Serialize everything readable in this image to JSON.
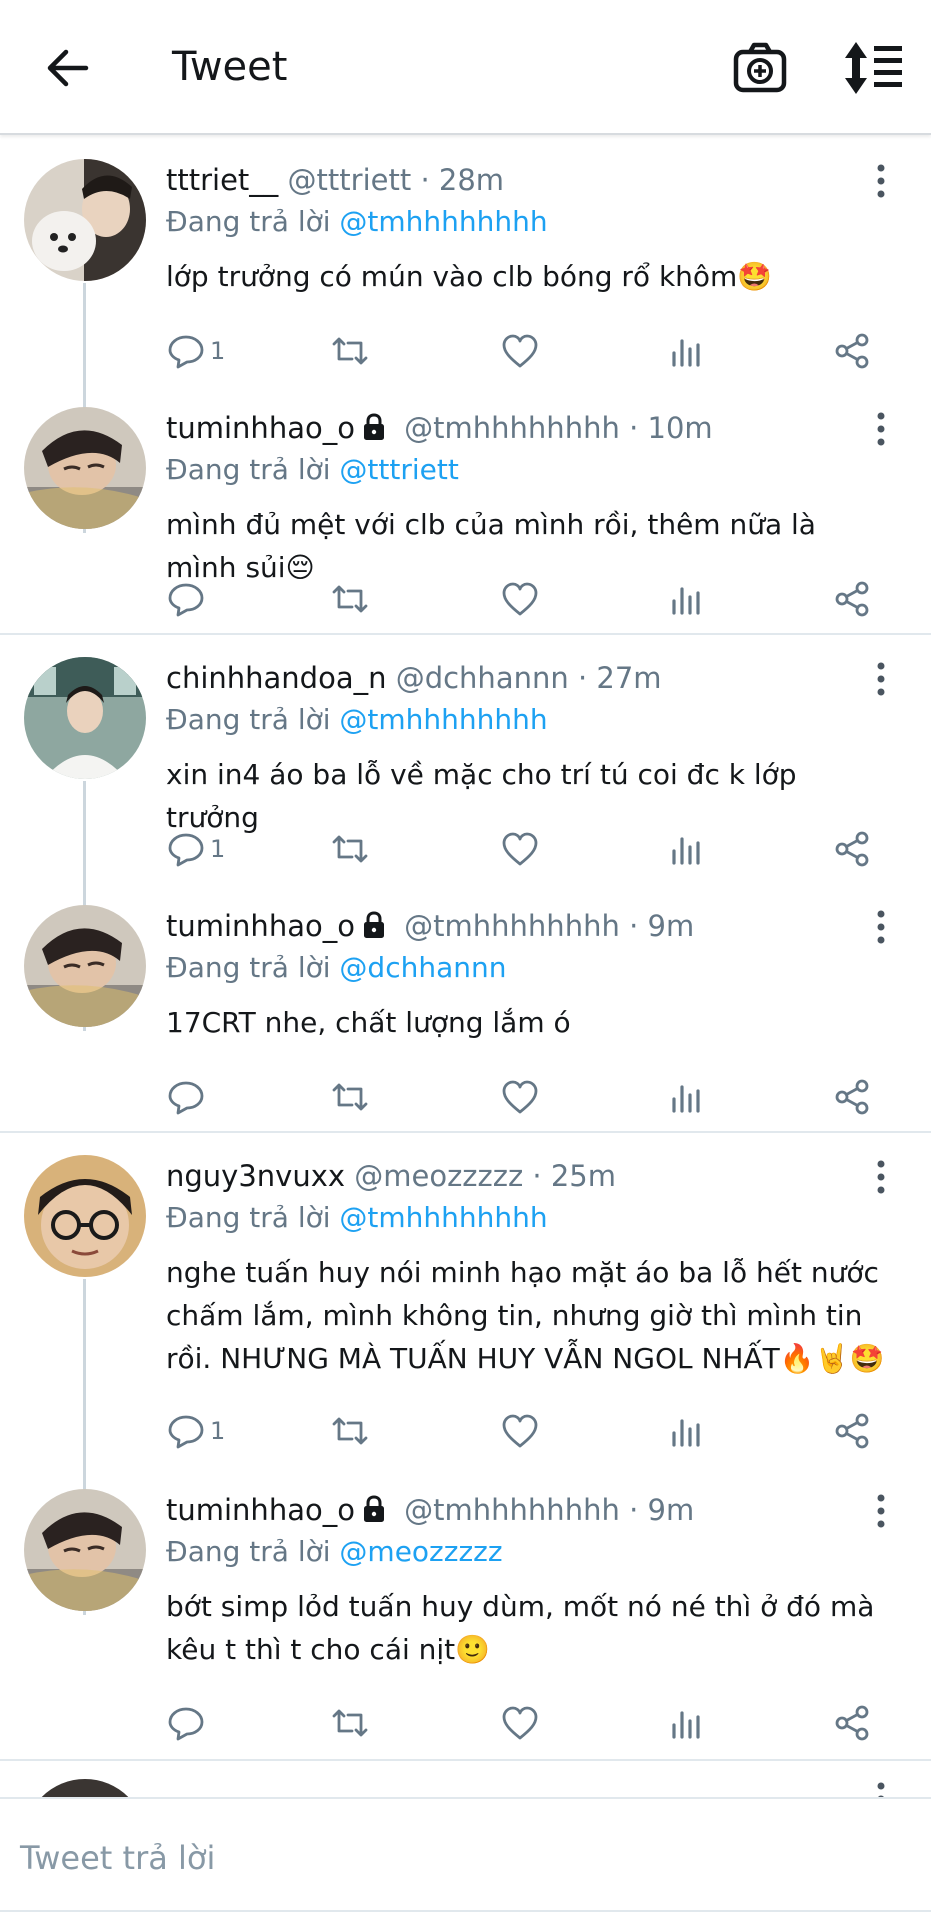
{
  "header": {
    "title": "Tweet",
    "icons": [
      "back-arrow-icon",
      "camera-plus-icon",
      "sort-icon"
    ]
  },
  "labels": {
    "reply_prefix": "Đang trả lời"
  },
  "colors": {
    "accent": "#1da1f2",
    "muted": "#657786",
    "text": "#14171a",
    "divider": "#e1e8ed"
  },
  "tweets": [
    {
      "username": "tttriet__",
      "handle": "@tttriett",
      "time": "28m",
      "reply_to": "@tmhhhhhhhh",
      "text": "lớp trưởng có mún vào clb bóng rổ khôm🤩",
      "reply_count": "1"
    },
    {
      "username": "tuminhhao_o",
      "handle": "@tmhhhhhhhh",
      "time": "10m",
      "reply_to": "@tttriett",
      "text": "mình đủ mệt với clb của mình rồi, thêm nữa là mình sủi😔",
      "reply_count": ""
    },
    {
      "username": "chinhhandoa_n",
      "handle": "@dchhannn",
      "time": "27m",
      "reply_to": "@tmhhhhhhhh",
      "text": "xin in4 áo ba lỗ về mặc cho trí tú coi đc k lớp trưởng",
      "reply_count": "1"
    },
    {
      "username": "tuminhhao_o",
      "handle": "@tmhhhhhhhh",
      "time": "9m",
      "reply_to": "@dchhannn",
      "text": " 17CRT nhe, chất lượng lắm ó",
      "reply_count": ""
    },
    {
      "username": "nguy3nvuxx",
      "handle": "@meozzzzz",
      "time": "25m",
      "reply_to": "@tmhhhhhhhh",
      "text": "nghe tuấn huy nói minh hạo mặt áo ba lỗ hết nước chấm lắm, mình không tin, nhưng giờ thì mình tin rồi. NHƯNG MÀ TUẤN HUY VẪN NGOL NHẤT🔥🤘🤩",
      "reply_count": "1"
    },
    {
      "username": "tuminhhao_o",
      "handle": "@tmhhhhhhhh",
      "time": "9m",
      "reply_to": "@meozzzzz",
      "text": "bớt simp lỏd tuấn huy dùm, mốt nó né thì ở đó mà kêu t thì t cho cái nịt🙂",
      "reply_count": ""
    }
  ],
  "composer": {
    "placeholder": "Tweet trả lời"
  }
}
